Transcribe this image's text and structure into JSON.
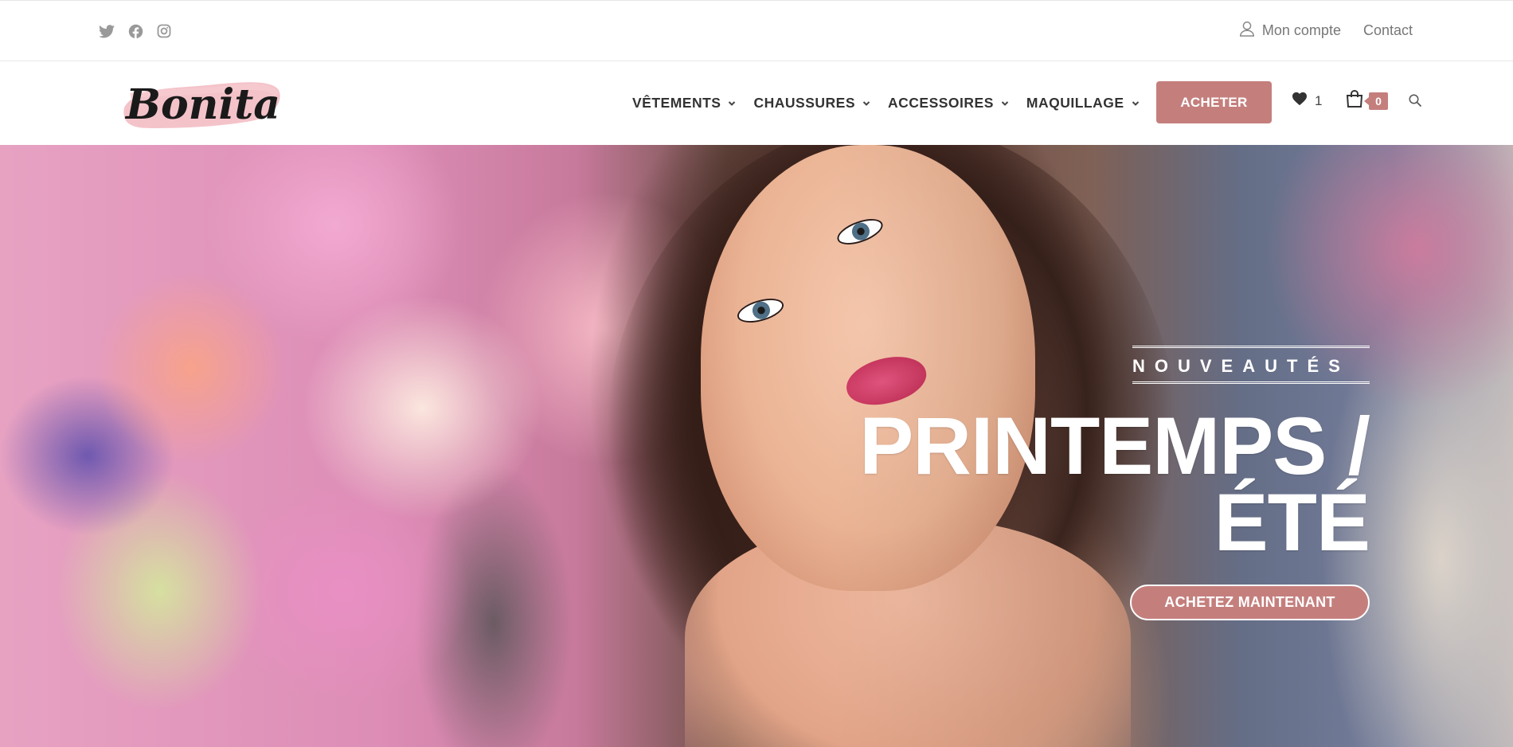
{
  "topbar": {
    "social_icons": [
      "twitter-icon",
      "facebook-icon",
      "instagram-icon"
    ],
    "account_label": "Mon compte",
    "contact_label": "Contact"
  },
  "header": {
    "logo_text": "Bonita",
    "nav": [
      {
        "label": "VÊTEMENTS"
      },
      {
        "label": "CHAUSSURES"
      },
      {
        "label": "ACCESSOIRES"
      },
      {
        "label": "MAQUILLAGE"
      }
    ],
    "buy_label": "ACHETER",
    "wishlist_count": "1",
    "cart_count": "0"
  },
  "hero": {
    "kicker": "NOUVEAUTÉS",
    "headline_line1": "PRINTEMPS /",
    "headline_line2": "ÉTÉ",
    "cta_label": "ACHETEZ MAINTENANT"
  },
  "colors": {
    "accent": "#c47f7d",
    "logo_brush": "#f2b9c1",
    "text": "#333333"
  }
}
